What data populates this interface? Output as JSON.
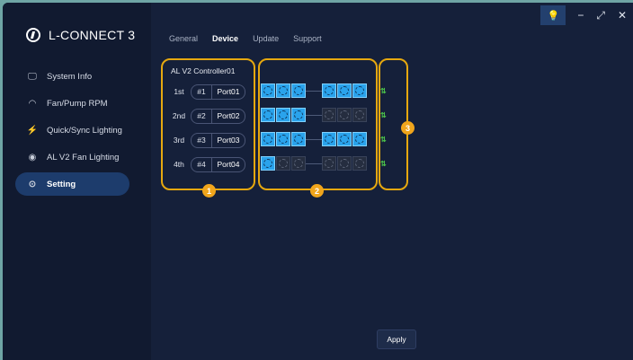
{
  "app": {
    "title": "L-CONNECT 3"
  },
  "window_controls": {
    "bulb": "💡",
    "minimize": "−",
    "maximize": "⤢",
    "close": "✕"
  },
  "sidebar": {
    "items": [
      {
        "label": "System Info",
        "icon": "monitor-icon",
        "glyph": "🖵"
      },
      {
        "label": "Fan/Pump RPM",
        "icon": "gauge-icon",
        "glyph": "◠"
      },
      {
        "label": "Quick/Sync Lighting",
        "icon": "lightning-icon",
        "glyph": "⚡"
      },
      {
        "label": "AL V2 Fan Lighting",
        "icon": "fan-light-icon",
        "glyph": "◉"
      },
      {
        "label": "Setting",
        "icon": "gear-icon",
        "glyph": "⊙",
        "active": true
      }
    ]
  },
  "tabs": [
    "General",
    "Device",
    "Update",
    "Support"
  ],
  "active_tab": "Device",
  "controller": {
    "name": "AL V2 Controller01",
    "rows": [
      {
        "order": "1st",
        "num": "#1",
        "port": "Port01",
        "fans": [
          1,
          1,
          1,
          1,
          1,
          1
        ]
      },
      {
        "order": "2nd",
        "num": "#2",
        "port": "Port02",
        "fans": [
          1,
          1,
          1,
          0,
          0,
          0
        ]
      },
      {
        "order": "3rd",
        "num": "#3",
        "port": "Port03",
        "fans": [
          1,
          1,
          1,
          1,
          1,
          1
        ]
      },
      {
        "order": "4th",
        "num": "#4",
        "port": "Port04",
        "fans": [
          1,
          0,
          0,
          0,
          0,
          0
        ]
      }
    ],
    "swap_glyph": "⇅"
  },
  "callouts": [
    "1",
    "2",
    "3"
  ],
  "apply_label": "Apply",
  "colors": {
    "accent": "#e6a80f",
    "fan_on": "#2aa3ec",
    "badge": "#f0a51c",
    "active_nav": "#1d3c6c"
  }
}
